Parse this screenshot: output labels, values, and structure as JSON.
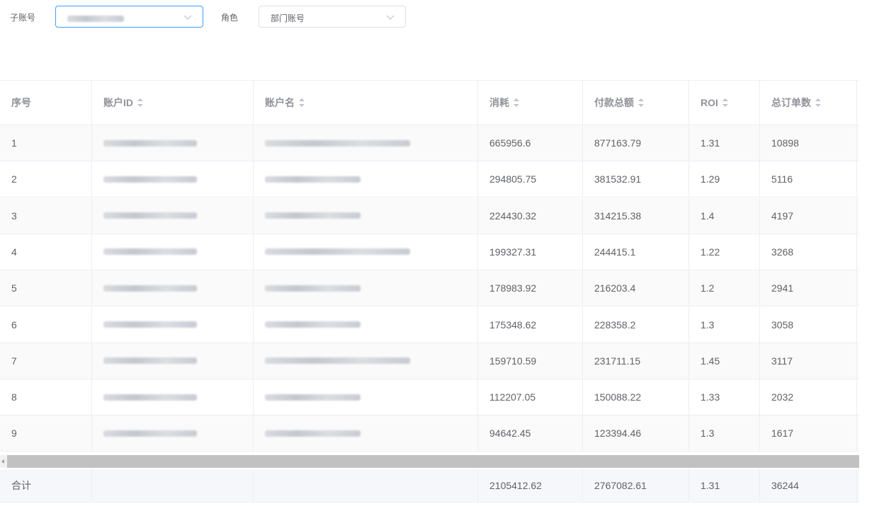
{
  "filters": {
    "sub_account_label": "子账号",
    "sub_account_value": "",
    "role_label": "角色",
    "role_value": "部门账号"
  },
  "table": {
    "headers": [
      "序号",
      "账户ID",
      "账户名",
      "消耗",
      "付款总额",
      "ROI",
      "总订单数"
    ],
    "sortable": [
      false,
      true,
      true,
      true,
      true,
      true,
      true
    ],
    "rows": [
      {
        "idx": "1",
        "cost": "665956.6",
        "pay": "877163.79",
        "roi": "1.31",
        "orders": "10898"
      },
      {
        "idx": "2",
        "cost": "294805.75",
        "pay": "381532.91",
        "roi": "1.29",
        "orders": "5116"
      },
      {
        "idx": "3",
        "cost": "224430.32",
        "pay": "314215.38",
        "roi": "1.4",
        "orders": "4197"
      },
      {
        "idx": "4",
        "cost": "199327.31",
        "pay": "244415.1",
        "roi": "1.22",
        "orders": "3268"
      },
      {
        "idx": "5",
        "cost": "178983.92",
        "pay": "216203.4",
        "roi": "1.2",
        "orders": "2941"
      },
      {
        "idx": "6",
        "cost": "175348.62",
        "pay": "228358.2",
        "roi": "1.3",
        "orders": "3058"
      },
      {
        "idx": "7",
        "cost": "159710.59",
        "pay": "231711.15",
        "roi": "1.45",
        "orders": "3117"
      },
      {
        "idx": "8",
        "cost": "112207.05",
        "pay": "150088.22",
        "roi": "1.33",
        "orders": "2032"
      },
      {
        "idx": "9",
        "cost": "94642.45",
        "pay": "123394.46",
        "roi": "1.3",
        "orders": "1617"
      }
    ],
    "totals": {
      "label": "合计",
      "cost": "2105412.62",
      "pay": "2767082.61",
      "roi": "1.31",
      "orders": "36244"
    }
  },
  "colors": {
    "active_border": "#409eff",
    "border": "#dcdfe6",
    "stripe": "#fafafa",
    "header_text": "#909399"
  }
}
